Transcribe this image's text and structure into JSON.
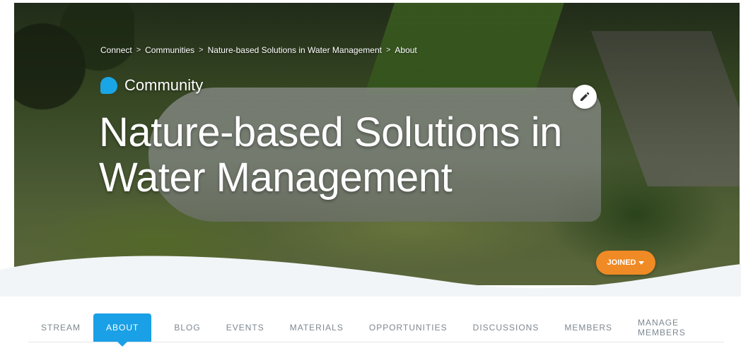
{
  "breadcrumb": {
    "items": [
      {
        "label": "Connect"
      },
      {
        "label": "Communities"
      },
      {
        "label": "Nature-based Solutions in Water Management"
      },
      {
        "label": "About"
      }
    ],
    "separator": ">"
  },
  "header": {
    "type_label": "Community",
    "title": "Nature-based Solutions in Water Management",
    "joined_label": "JOINED"
  },
  "tabs": [
    {
      "label": "STREAM"
    },
    {
      "label": "ABOUT",
      "active": true
    },
    {
      "label": "BLOG"
    },
    {
      "label": "EVENTS"
    },
    {
      "label": "MATERIALS"
    },
    {
      "label": "OPPORTUNITIES"
    },
    {
      "label": "DISCUSSIONS"
    },
    {
      "label": "MEMBERS"
    },
    {
      "label": "MANAGE MEMBERS"
    }
  ],
  "icons": {
    "edit": "pencil-icon",
    "community": "community-blob-icon",
    "joined_caret": "chevron-down-icon"
  },
  "colors": {
    "accent": "#1aa0e6",
    "joined": "#f08a24",
    "panel": "#f1f5f7"
  }
}
